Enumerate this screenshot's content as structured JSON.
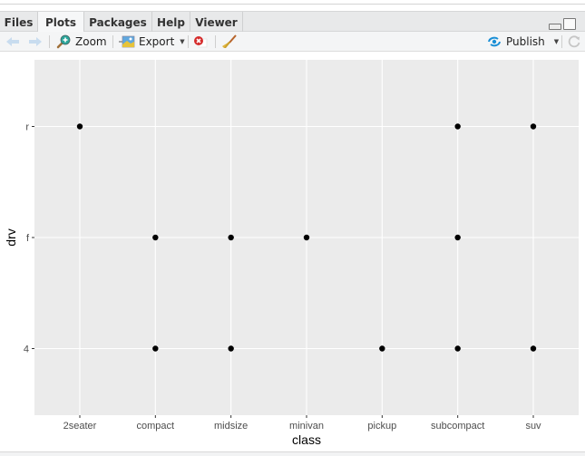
{
  "tabs": [
    {
      "label": "Files",
      "active": false
    },
    {
      "label": "Plots",
      "active": true
    },
    {
      "label": "Packages",
      "active": false
    },
    {
      "label": "Help",
      "active": false
    },
    {
      "label": "Viewer",
      "active": false
    }
  ],
  "toolbar": {
    "back_icon": "arrow-left-icon",
    "forward_icon": "arrow-right-icon",
    "zoom_label": "Zoom",
    "export_label": "Export",
    "remove_icon": "remove-plot-icon",
    "clear_icon": "broom-icon",
    "publish_label": "Publish",
    "refresh_icon": "refresh-icon"
  },
  "colors": {
    "panel_bg": "#ebebeb",
    "grid": "#ffffff",
    "point": "#000000",
    "axis_text": "#4d4d4d",
    "publish_accent": "#1a8fd6"
  },
  "chart_data": {
    "type": "scatter",
    "title": "",
    "xlabel": "class",
    "ylabel": "drv",
    "x_categories": [
      "2seater",
      "compact",
      "midsize",
      "minivan",
      "pickup",
      "subcompact",
      "suv"
    ],
    "y_categories": [
      "4",
      "f",
      "r"
    ],
    "grid": true,
    "points": [
      {
        "x": "2seater",
        "y": "r"
      },
      {
        "x": "compact",
        "y": "f"
      },
      {
        "x": "compact",
        "y": "4"
      },
      {
        "x": "midsize",
        "y": "f"
      },
      {
        "x": "midsize",
        "y": "4"
      },
      {
        "x": "minivan",
        "y": "f"
      },
      {
        "x": "pickup",
        "y": "4"
      },
      {
        "x": "subcompact",
        "y": "r"
      },
      {
        "x": "subcompact",
        "y": "f"
      },
      {
        "x": "subcompact",
        "y": "4"
      },
      {
        "x": "suv",
        "y": "r"
      },
      {
        "x": "suv",
        "y": "4"
      }
    ]
  }
}
